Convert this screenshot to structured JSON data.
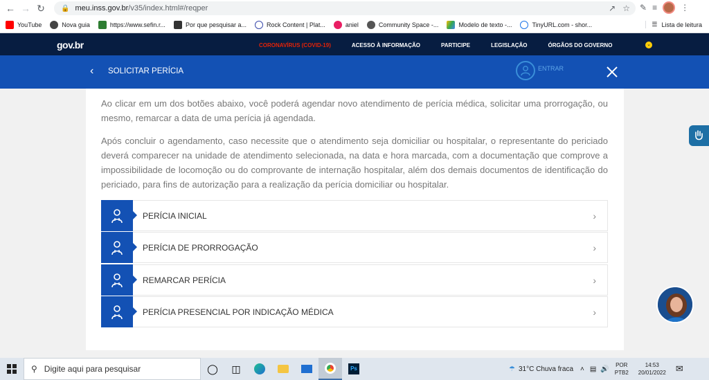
{
  "browser": {
    "url_domain": "meu.inss.gov.br",
    "url_path": "/v35/index.html#/reqper",
    "bookmarks": [
      {
        "label": "YouTube",
        "color": "#ff0000"
      },
      {
        "label": "Nova guia",
        "color": "#444444"
      },
      {
        "label": "https://www.sefin.r...",
        "color": "#2e7d32"
      },
      {
        "label": "Por que pesquisar a...",
        "color": "#333333"
      },
      {
        "label": "Rock Content | Plat...",
        "color": "#3949ab"
      },
      {
        "label": "aniel",
        "color": "#e91e63"
      },
      {
        "label": "Community Space -...",
        "color": "#555555"
      },
      {
        "label": "Modelo de texto -...",
        "color": "#fbbc04"
      },
      {
        "label": "TinyURL.com - shor...",
        "color": "#1a73e8"
      }
    ],
    "reading_list": "Lista de leitura"
  },
  "govbar": {
    "logo": "gov.br",
    "nav": [
      "CORONAVÍRUS (COVID-19)",
      "ACESSO À INFORMAÇÃO",
      "PARTICIPE",
      "LEGISLAÇÃO",
      "ÓRGÃOS DO GOVERNO"
    ]
  },
  "header": {
    "title": "SOLICITAR PERÍCIA",
    "login_label": "ENTRAR"
  },
  "content": {
    "paragraph1": "Ao clicar em um dos botões abaixo, você poderá agendar novo atendimento de perícia médica, solicitar uma prorrogação, ou mesmo, remarcar a data de uma perícia já agendada.",
    "paragraph2": "Após concluir o agendamento, caso necessite que o atendimento seja domiciliar ou hospitalar, o representante do periciado deverá comparecer na unidade de atendimento selecionada, na data e hora marcada, com a documentação que comprove a impossibilidade de locomoção ou do comprovante de internação hospitalar, além dos demais documentos de identificação do periciado, para fins de autorização para a realização da perícia domiciliar ou hospitalar.",
    "options": [
      {
        "label": "PERÍCIA INICIAL"
      },
      {
        "label": "PERÍCIA DE PRORROGAÇÃO"
      },
      {
        "label": "REMARCAR PERÍCIA"
      },
      {
        "label": "PERÍCIA PRESENCIAL POR INDICAÇÃO MÉDICA"
      }
    ]
  },
  "taskbar": {
    "search_placeholder": "Digite aqui para pesquisar",
    "weather": "31°C  Chuva fraca",
    "lang_top": "POR",
    "lang_bottom": "PTB2",
    "time": "14:53",
    "date": "20/01/2022"
  },
  "colors": {
    "gov_dark": "#071d41",
    "gov_blue": "#1351b4",
    "covid_red": "#e52207"
  }
}
